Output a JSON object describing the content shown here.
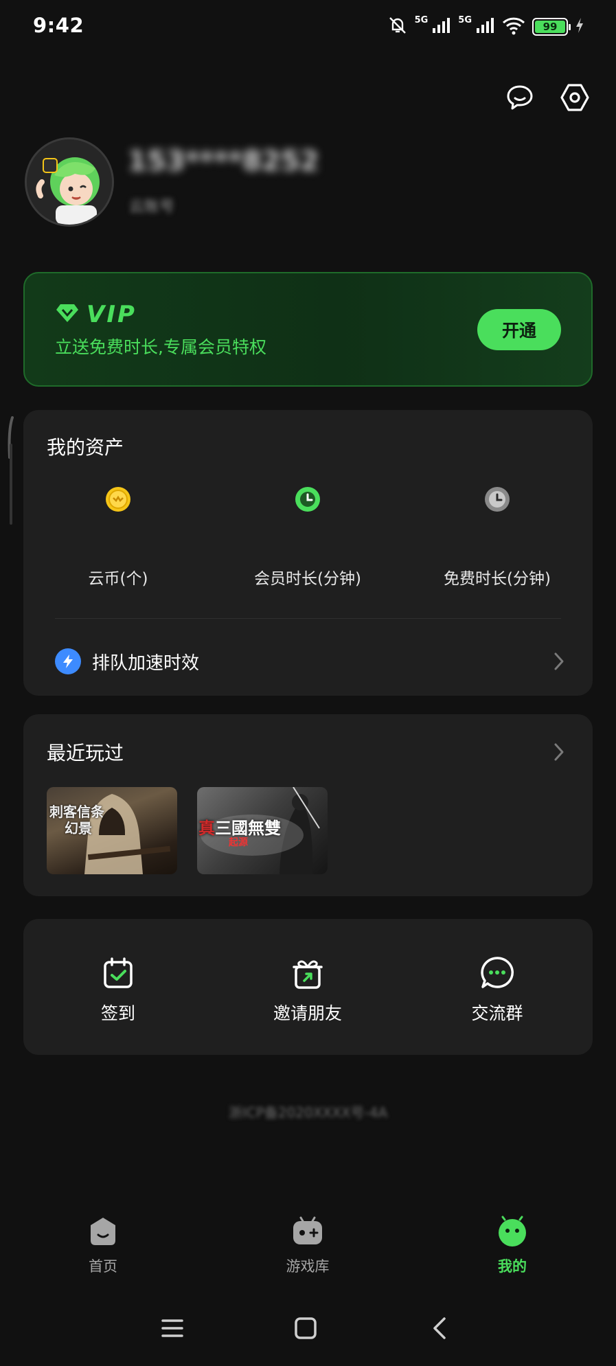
{
  "status_bar": {
    "time": "9:42",
    "network_1": "5G",
    "network_2": "5G",
    "battery": "99"
  },
  "top_actions": {
    "icons": [
      "chat-bubble-icon",
      "settings-hex-icon"
    ]
  },
  "profile": {
    "name": "153****8252",
    "sub": "云账号"
  },
  "vip": {
    "title": "VIP",
    "description": "立送免费时长,专属会员特权",
    "button": "开通"
  },
  "assets": {
    "title": "我的资产",
    "items": [
      {
        "label": "云币(个)",
        "icon": "coin-icon",
        "color": "#f5c518"
      },
      {
        "label": "会员时长(分钟)",
        "icon": "member-clock-icon",
        "color": "#4ade5c"
      },
      {
        "label": "免费时长(分钟)",
        "icon": "free-clock-icon",
        "color": "#9a9a9a"
      }
    ],
    "queue_label": "排队加速时效"
  },
  "recent": {
    "title": "最近玩过",
    "games": [
      {
        "line1": "刺客信条",
        "line2": "幻景"
      },
      {
        "title_red": "真",
        "title_rest": "三國無雙",
        "subtitle": "起源"
      }
    ]
  },
  "shortcuts": [
    {
      "label": "签到",
      "icon": "calendar-check-icon"
    },
    {
      "label": "邀请朋友",
      "icon": "gift-share-icon"
    },
    {
      "label": "交流群",
      "icon": "chat-dots-icon"
    }
  ],
  "footer_note": "浙ICP备2020XXXX号-4A",
  "tabs": [
    {
      "label": "首页",
      "icon": "home-icon",
      "active": false
    },
    {
      "label": "游戏库",
      "icon": "gamepad-icon",
      "active": false
    },
    {
      "label": "我的",
      "icon": "mine-face-icon",
      "active": true
    }
  ],
  "colors": {
    "accent": "#4ade5c",
    "background": "#111111",
    "card": "#1f1f1f"
  }
}
